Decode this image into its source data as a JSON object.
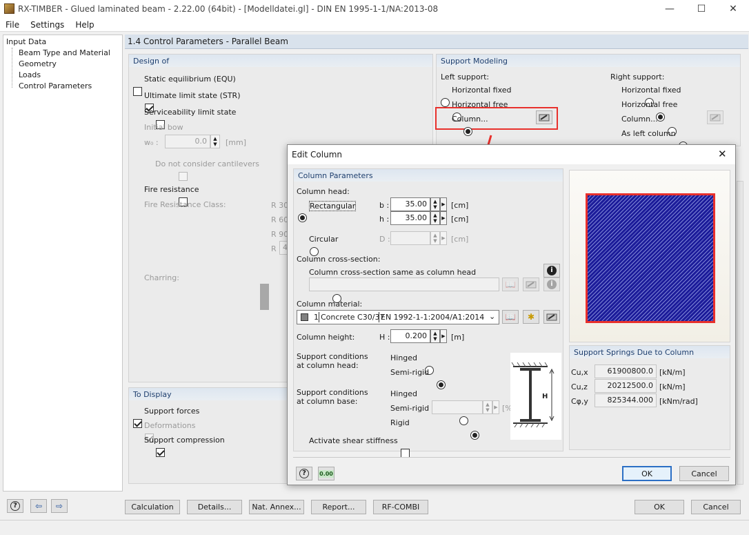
{
  "app": {
    "title": "RX-TIMBER - Glued laminated beam - 2.22.00 (64bit) - [Modelldatei.gl] - DIN EN 1995-1-1/NA:2013-08"
  },
  "menu": [
    "File",
    "Settings",
    "Help"
  ],
  "tree": {
    "root": "Input Data",
    "items": [
      "Beam Type and Material",
      "Geometry",
      "Loads",
      "Control Parameters"
    ]
  },
  "main_title": "1.4 Control Parameters  -  Parallel Beam",
  "design_of": {
    "title": "Design of",
    "equ": "Static equilibrium (EQU)",
    "str": "Ultimate limit state (STR)",
    "sls": "Serviceability limit state",
    "initial_bow": "Initial bow",
    "w0_label": "w₀ :",
    "w0_value": "0.0",
    "w0_unit": "[mm]",
    "cantilevers": "Do not consider cantilevers",
    "fire": "Fire resistance",
    "fire_class": "Fire Resistance Class:",
    "r30": "R 30",
    "r60": "R 60",
    "r90": "R 90",
    "r": "R",
    "r_value": "4",
    "charring": "Charring:"
  },
  "to_display": {
    "title": "To Display",
    "forces": "Support forces",
    "deformations": "Deformations",
    "compression": "Support compression"
  },
  "support": {
    "title": "Support Modeling",
    "left": "Left support:",
    "right": "Right support:",
    "h_fixed": "Horizontal fixed",
    "h_free": "Horizontal free",
    "column": "Column...",
    "as_left": "As left column"
  },
  "dialog": {
    "title": "Edit Column",
    "params_title": "Column Parameters",
    "head": "Column head:",
    "rect": "Rectangular",
    "b": "b :",
    "b_value": "35.00",
    "h": "h :",
    "h_value": "35.00",
    "cm": "[cm]",
    "circ": "Circular",
    "d": "D :",
    "cross": "Column cross-section:",
    "cross_same": "Column cross-section same as column head",
    "material": "Column material:",
    "mat_no": "1",
    "mat_name": "Concrete C30/37",
    "mat_norm": "EN 1992-1-1:2004/A1:2014",
    "height": "Column height:",
    "H": "H :",
    "H_value": "0.200",
    "m": "[m]",
    "cond_head": "Support conditions at column head:",
    "cond_base": "Support conditions at column base:",
    "hinged": "Hinged",
    "semi": "Semi-rigid",
    "rigid": "Rigid",
    "pct": "[%]",
    "shear": "Activate shear stiffness",
    "springs_title": "Support Springs Due to Column",
    "cux": "Cu,x",
    "cux_value": "61900800.0",
    "cux_unit": "[kN/m]",
    "cuz": "Cu,z",
    "cuz_value": "20212500.0",
    "cuz_unit": "[kN/m]",
    "cphi": "Cφ,y",
    "cphi_value": "825344.000",
    "cphi_unit": "[kNm/rad]",
    "ok": "OK",
    "cancel": "Cancel"
  },
  "bottom": {
    "calc": "Calculation",
    "details": "Details...",
    "annex": "Nat. Annex...",
    "report": "Report...",
    "rfcombi": "RF-COMBI",
    "ok": "OK",
    "cancel": "Cancel"
  },
  "colors": {
    "highlight": "#e8302c",
    "section_hdr": "#dde6f0",
    "hatch": "#1c1c9a"
  }
}
